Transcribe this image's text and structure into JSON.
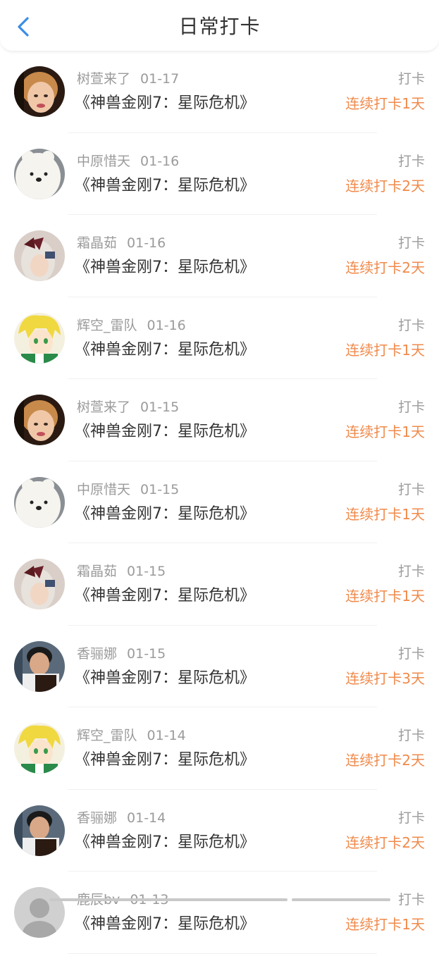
{
  "header": {
    "title": "日常打卡",
    "back_icon": "chevron-left-icon",
    "accent_color": "#3a8ee6"
  },
  "colors": {
    "meta_text": "#9b9b9b",
    "primary_text": "#333333",
    "streak_text": "#f08a4b"
  },
  "entries": [
    {
      "user": "树萱来了",
      "date": "01-17",
      "book": "《神兽金刚7：星际危机》",
      "action": "打卡",
      "streak": "连续打卡1天",
      "avatar": "avatar-child"
    },
    {
      "user": "中原惜天",
      "date": "01-16",
      "book": "《神兽金刚7：星际危机》",
      "action": "打卡",
      "streak": "连续打卡2天",
      "avatar": "avatar-bear"
    },
    {
      "user": "霜晶茹",
      "date": "01-16",
      "book": "《神兽金刚7：星际危机》",
      "action": "打卡",
      "streak": "连续打卡2天",
      "avatar": "avatar-girl"
    },
    {
      "user": "辉空_雷队",
      "date": "01-16",
      "book": "《神兽金刚7：星际危机》",
      "action": "打卡",
      "streak": "连续打卡1天",
      "avatar": "avatar-anime"
    },
    {
      "user": "树萱来了",
      "date": "01-15",
      "book": "《神兽金刚7：星际危机》",
      "action": "打卡",
      "streak": "连续打卡1天",
      "avatar": "avatar-child"
    },
    {
      "user": "中原惜天",
      "date": "01-15",
      "book": "《神兽金刚7：星际危机》",
      "action": "打卡",
      "streak": "连续打卡1天",
      "avatar": "avatar-bear"
    },
    {
      "user": "霜晶茹",
      "date": "01-15",
      "book": "《神兽金刚7：星际危机》",
      "action": "打卡",
      "streak": "连续打卡1天",
      "avatar": "avatar-girl"
    },
    {
      "user": "香骊娜",
      "date": "01-15",
      "book": "《神兽金刚7：星际危机》",
      "action": "打卡",
      "streak": "连续打卡3天",
      "avatar": "avatar-man"
    },
    {
      "user": "辉空_雷队",
      "date": "01-14",
      "book": "《神兽金刚7：星际危机》",
      "action": "打卡",
      "streak": "连续打卡2天",
      "avatar": "avatar-anime"
    },
    {
      "user": "香骊娜",
      "date": "01-14",
      "book": "《神兽金刚7：星际危机》",
      "action": "打卡",
      "streak": "连续打卡2天",
      "avatar": "avatar-man"
    },
    {
      "user": "鹿辰bv",
      "date": "01-13",
      "book": "《神兽金刚7：星际危机》",
      "action": "打卡",
      "streak": "连续打卡1天",
      "avatar": "avatar-gray"
    }
  ]
}
